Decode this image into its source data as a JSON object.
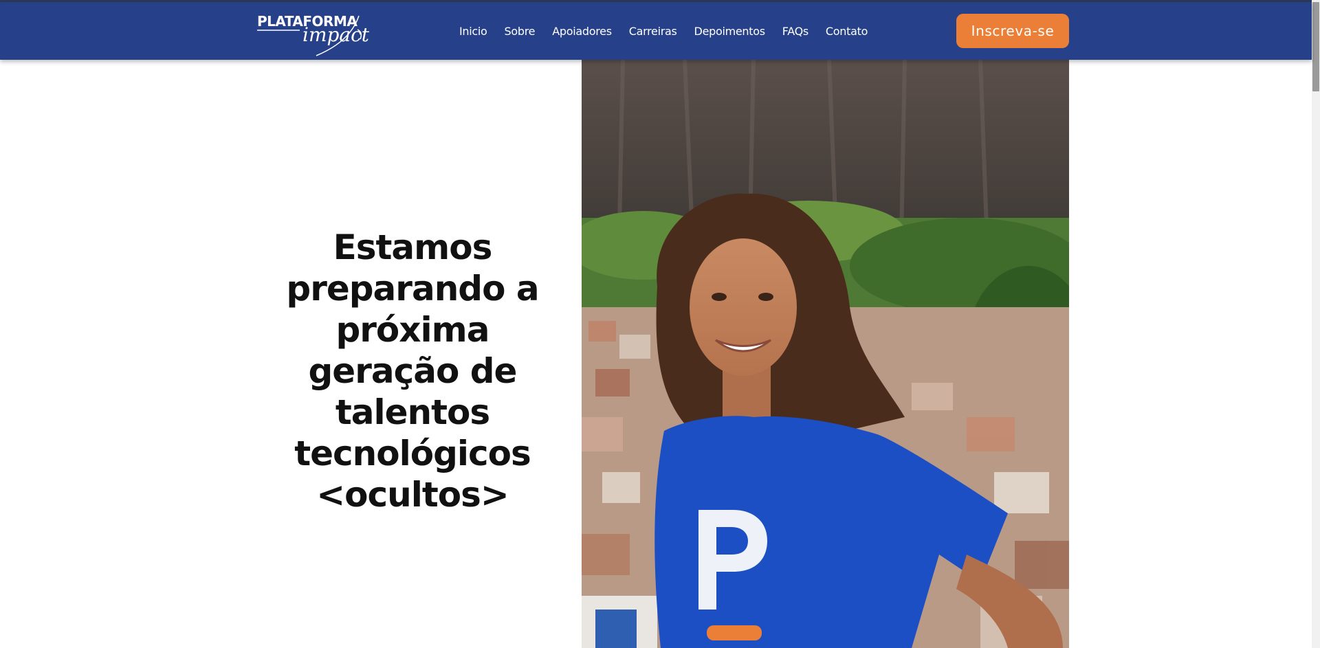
{
  "brand": {
    "logo_top": "PLATAFORMA",
    "logo_script": "impact"
  },
  "nav": {
    "items": [
      "Inicio",
      "Sobre",
      "Apoiadores",
      "Carreiras",
      "Depoimentos",
      "FAQs",
      "Contato"
    ]
  },
  "cta": {
    "label": "Inscreva-se"
  },
  "hero": {
    "headline": "Estamos preparando a próxima geração de talentos tecnológicos <ocultos>"
  },
  "colors": {
    "header_bg": "#26418a",
    "cta_bg": "#ec7f37",
    "shirt_blue": "#1c4fc4",
    "text_dark": "#111111"
  }
}
